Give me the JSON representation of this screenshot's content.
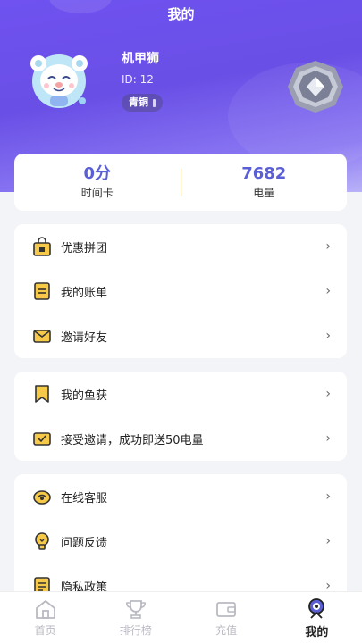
{
  "header": {
    "title": "我的"
  },
  "user": {
    "name": "机甲狮",
    "id_text": "ID: 12",
    "level": "青铜"
  },
  "stats": [
    {
      "value": "0分",
      "label": "时间卡"
    },
    {
      "value": "7682",
      "label": "电量"
    }
  ],
  "menu_groups": [
    [
      {
        "label": "优惠拼团",
        "icon": "shopping-bag-icon"
      },
      {
        "label": "我的账单",
        "icon": "bill-icon"
      },
      {
        "label": "邀请好友",
        "icon": "envelope-icon"
      }
    ],
    [
      {
        "label": "我的鱼获",
        "icon": "bookmark-icon"
      },
      {
        "label": "接受邀请，成功即送50电量",
        "icon": "check-mail-icon"
      }
    ],
    [
      {
        "label": "在线客服",
        "icon": "headset-icon"
      },
      {
        "label": "问题反馈",
        "icon": "bulb-icon"
      },
      {
        "label": "隐私政策",
        "icon": "document-icon"
      }
    ]
  ],
  "tabs": [
    {
      "label": "首页",
      "icon": "home-icon",
      "active": false
    },
    {
      "label": "排行榜",
      "icon": "trophy-icon",
      "active": false
    },
    {
      "label": "充值",
      "icon": "wallet-icon",
      "active": false
    },
    {
      "label": "我的",
      "icon": "profile-icon",
      "active": true
    }
  ],
  "colors": {
    "header_gradient_start": "#6f52f0",
    "accent": "#5b5fd6",
    "icon_yellow": "#f7c948",
    "tab_inactive": "#b9b9c2"
  }
}
